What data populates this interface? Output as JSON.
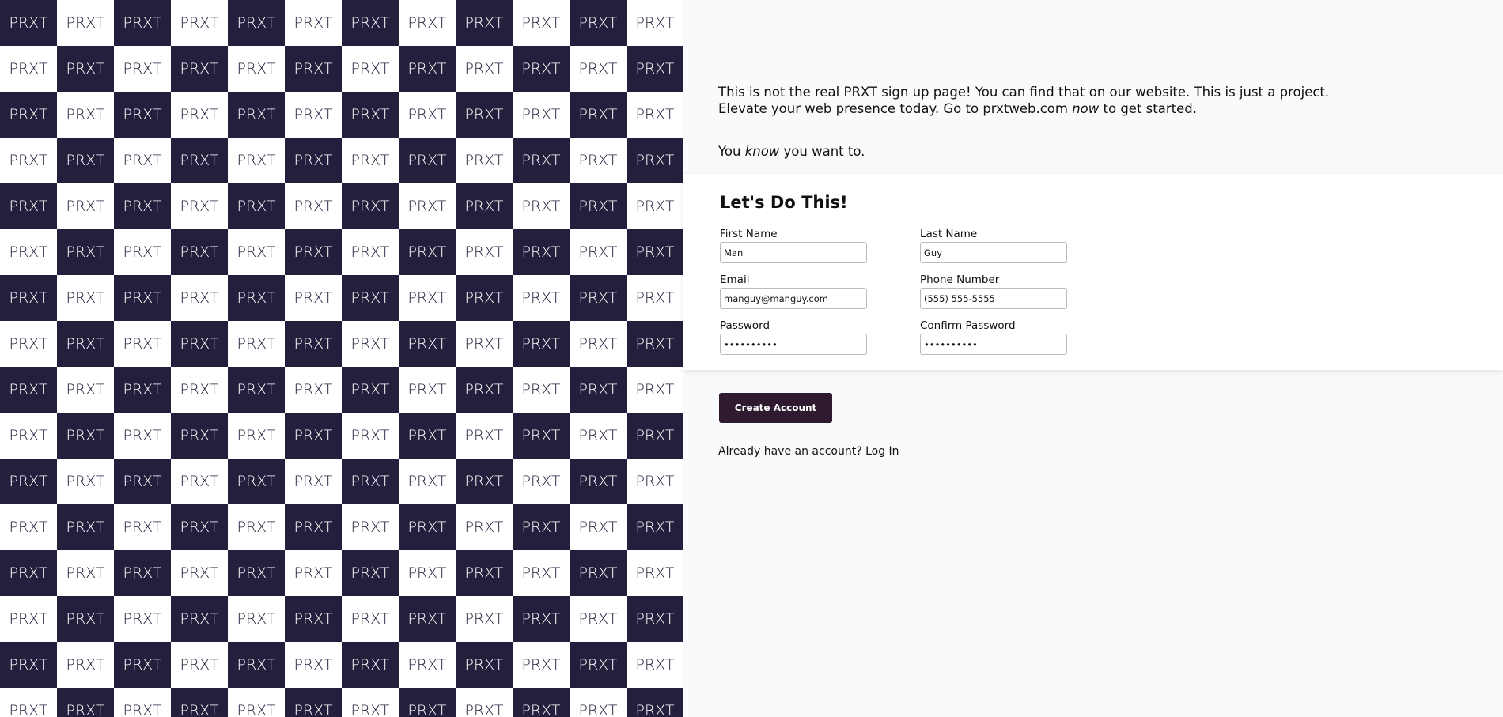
{
  "pattern": {
    "tile_text": "PRXT",
    "colors": {
      "dark": "#22203c",
      "light": "#ffffff"
    }
  },
  "intro": {
    "part1": "This is not the real PRXT sign up page! You can find that on our website. This is just a project. Elevate your web presence today. Go to prxtweb.com ",
    "emphasis": "now",
    "part2": " to get started."
  },
  "tagline": {
    "part1": "You ",
    "emphasis": "know",
    "part2": " you want to."
  },
  "form": {
    "title": "Let's Do This!",
    "first_name": {
      "label": "First Name",
      "value": "Man"
    },
    "last_name": {
      "label": "Last Name",
      "value": "Guy"
    },
    "email": {
      "label": "Email",
      "value": "manguy@manguy.com"
    },
    "phone": {
      "label": "Phone Number",
      "value": "(555) 555-5555"
    },
    "password": {
      "label": "Password",
      "value": "••••••••••"
    },
    "confirm_password": {
      "label": "Confirm Password",
      "value": "••••••••••"
    }
  },
  "actions": {
    "create_account_label": "Create Account",
    "login_prompt": "Already have an account? ",
    "login_link": "Log In"
  },
  "colors": {
    "button_bg": "#2f1a30",
    "page_bg": "#f9fafb"
  }
}
